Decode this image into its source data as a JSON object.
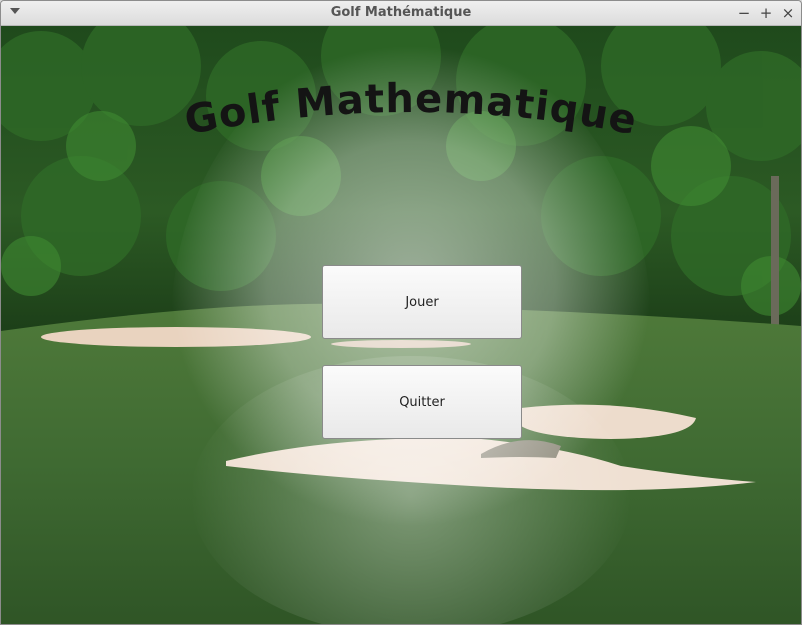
{
  "window": {
    "title": "Golf Mathématique",
    "controls": {
      "minimize": "−",
      "maximize": "+",
      "close": "×"
    }
  },
  "game": {
    "title": "Golf Mathematique"
  },
  "menu": {
    "play_label": "Jouer",
    "quit_label": "Quitter"
  }
}
